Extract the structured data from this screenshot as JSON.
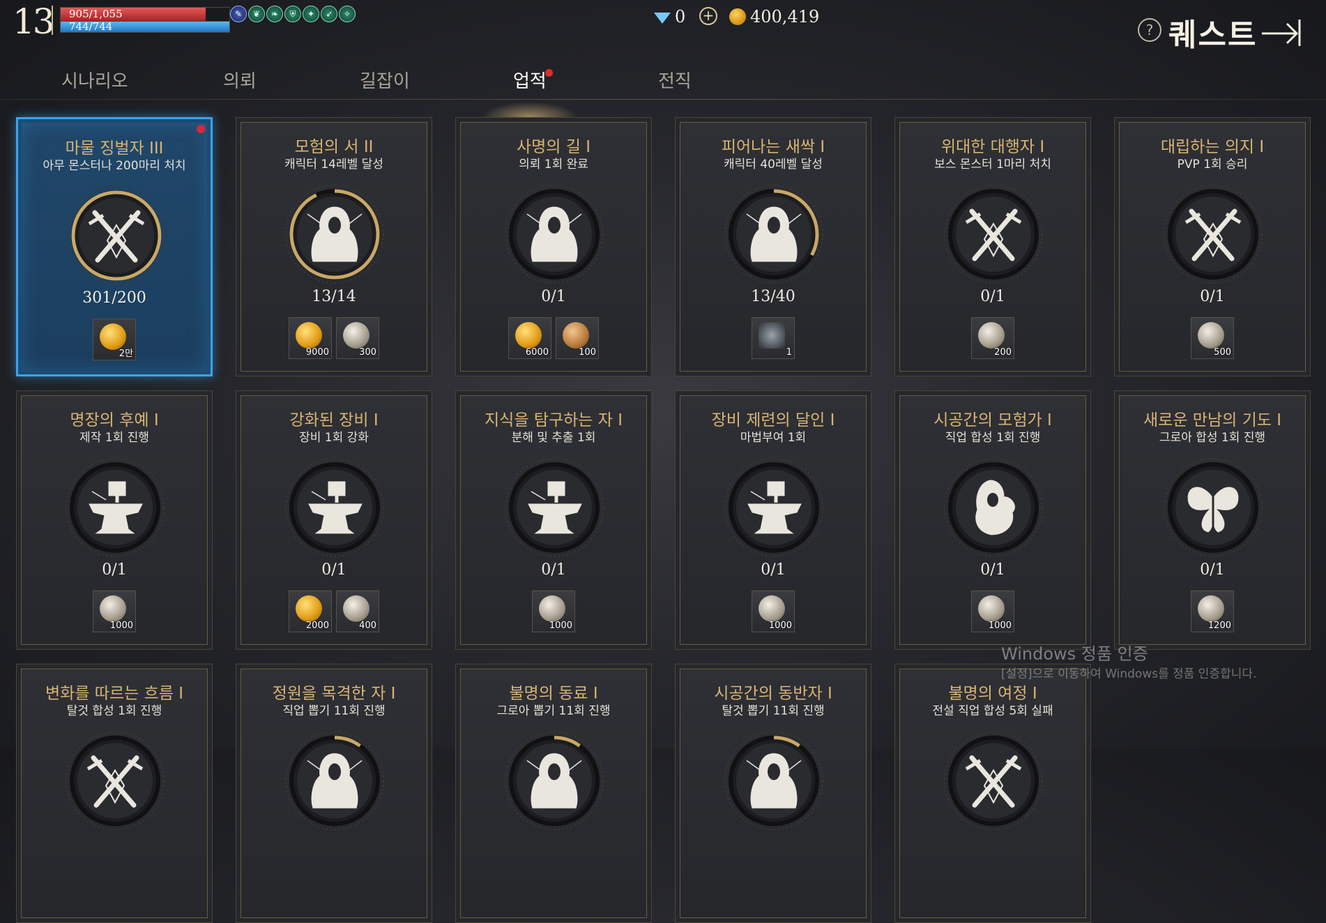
{
  "hud": {
    "level": "13",
    "hp_text": "905/1,055",
    "hp_fraction": 0.858,
    "mp_text": "744/744",
    "mp_fraction": 1.0,
    "buff_icons": [
      "quill-buff-icon",
      "leaf-buff-icon",
      "wing-buff-icon",
      "shield-buff-icon",
      "feather-buff-icon",
      "bird-buff-icon",
      "flame-buff-icon"
    ],
    "gems": "0",
    "gold": "400,419",
    "title": "퀘스트"
  },
  "tabs": [
    {
      "label": "시나리오",
      "active": false
    },
    {
      "label": "의뢰",
      "active": false
    },
    {
      "label": "길잡이",
      "active": false
    },
    {
      "label": "업적",
      "active": true,
      "alert": true
    },
    {
      "label": "전직",
      "active": false
    }
  ],
  "cards": [
    {
      "title": "마물 징벌자 III",
      "desc": "아무 몬스터나 200마리 처치",
      "progress": "301/200",
      "ratio": 1.0,
      "emblem": "crossed-swords",
      "selected": true,
      "alert": true,
      "rewards": [
        {
          "type": "gold",
          "amount": "2만"
        }
      ]
    },
    {
      "title": "모험의 서 II",
      "desc": "캐릭터 14레벨 달성",
      "progress": "13/14",
      "ratio": 0.93,
      "emblem": "hooded-figure",
      "selected": false,
      "rewards": [
        {
          "type": "gold",
          "amount": "9000"
        },
        {
          "type": "silver",
          "amount": "300"
        }
      ]
    },
    {
      "title": "사명의 길 I",
      "desc": "의뢰 1회 완료",
      "progress": "0/1",
      "ratio": 0,
      "emblem": "hooded-figure",
      "selected": false,
      "rewards": [
        {
          "type": "gold",
          "amount": "6000"
        },
        {
          "type": "bronze",
          "amount": "100"
        }
      ]
    },
    {
      "title": "피어나는 새싹 I",
      "desc": "캐릭터 40레벨 달성",
      "progress": "13/40",
      "ratio": 0.33,
      "emblem": "hooded-figure",
      "selected": false,
      "rewards": [
        {
          "type": "scroll",
          "amount": "1"
        }
      ]
    },
    {
      "title": "위대한 대행자 I",
      "desc": "보스 몬스터 1마리 처치",
      "progress": "0/1",
      "ratio": 0,
      "emblem": "crossed-swords",
      "selected": false,
      "rewards": [
        {
          "type": "silver",
          "amount": "200"
        }
      ]
    },
    {
      "title": "대립하는 의지 I",
      "desc": "PVP 1회 승리",
      "progress": "0/1",
      "ratio": 0,
      "emblem": "crossed-swords",
      "selected": false,
      "rewards": [
        {
          "type": "silver",
          "amount": "500"
        }
      ]
    },
    {
      "title": "명장의 후예 I",
      "desc": "제작 1회 진행",
      "progress": "0/1",
      "ratio": 0,
      "emblem": "anvil",
      "selected": false,
      "rewards": [
        {
          "type": "silver",
          "amount": "1000"
        }
      ]
    },
    {
      "title": "강화된 장비 I",
      "desc": "장비 1회 강화",
      "progress": "0/1",
      "ratio": 0,
      "emblem": "anvil",
      "selected": false,
      "rewards": [
        {
          "type": "gold",
          "amount": "2000"
        },
        {
          "type": "silver",
          "amount": "400"
        }
      ]
    },
    {
      "title": "지식을 탐구하는 자 I",
      "desc": "분해 및 추출 1회",
      "progress": "0/1",
      "ratio": 0,
      "emblem": "anvil",
      "selected": false,
      "rewards": [
        {
          "type": "silver",
          "amount": "1000"
        }
      ]
    },
    {
      "title": "장비 제련의 달인 I",
      "desc": "마법부여 1회",
      "progress": "0/1",
      "ratio": 0,
      "emblem": "anvil",
      "selected": false,
      "rewards": [
        {
          "type": "silver",
          "amount": "1000"
        }
      ]
    },
    {
      "title": "시공간의 모험가 I",
      "desc": "직업 합성 1회 진행",
      "progress": "0/1",
      "ratio": 0,
      "emblem": "cloaked-figure",
      "selected": false,
      "rewards": [
        {
          "type": "silver",
          "amount": "1000"
        }
      ]
    },
    {
      "title": "새로운 만남의 기도 I",
      "desc": "그로아 합성 1회 진행",
      "progress": "0/1",
      "ratio": 0,
      "emblem": "butterfly",
      "selected": false,
      "rewards": [
        {
          "type": "silver",
          "amount": "1200"
        }
      ]
    },
    {
      "title": "변화를 따르는 흐름 I",
      "desc": "탈것 합성 1회 진행",
      "progress": "",
      "ratio": 0,
      "emblem": "crossed-swords",
      "selected": false,
      "rewards": []
    },
    {
      "title": "정원을 목격한 자 I",
      "desc": "직업 뽑기 11회 진행",
      "progress": "",
      "ratio": 0.1,
      "emblem": "hooded-figure",
      "selected": false,
      "rewards": []
    },
    {
      "title": "불명의 동료 I",
      "desc": "그로아 뽑기 11회 진행",
      "progress": "",
      "ratio": 0.1,
      "emblem": "hooded-figure",
      "selected": false,
      "rewards": []
    },
    {
      "title": "시공간의 동반자 I",
      "desc": "탈것 뽑기 11회 진행",
      "progress": "",
      "ratio": 0.1,
      "emblem": "hooded-figure",
      "selected": false,
      "rewards": []
    },
    {
      "title": "불명의 여정 I",
      "desc": "전설 직업 합성 5회 실패",
      "progress": "",
      "ratio": 0,
      "emblem": "crossed-swords",
      "selected": false,
      "rewards": []
    }
  ],
  "watermark": {
    "title": "Windows 정품 인증",
    "subtitle": "[설정]으로 이동하여 Windows를 정품 인증합니다."
  },
  "colors": {
    "accent_gold": "#d9b472",
    "selected_blue": "#39a4f0",
    "alert_red": "#e02b2b"
  }
}
